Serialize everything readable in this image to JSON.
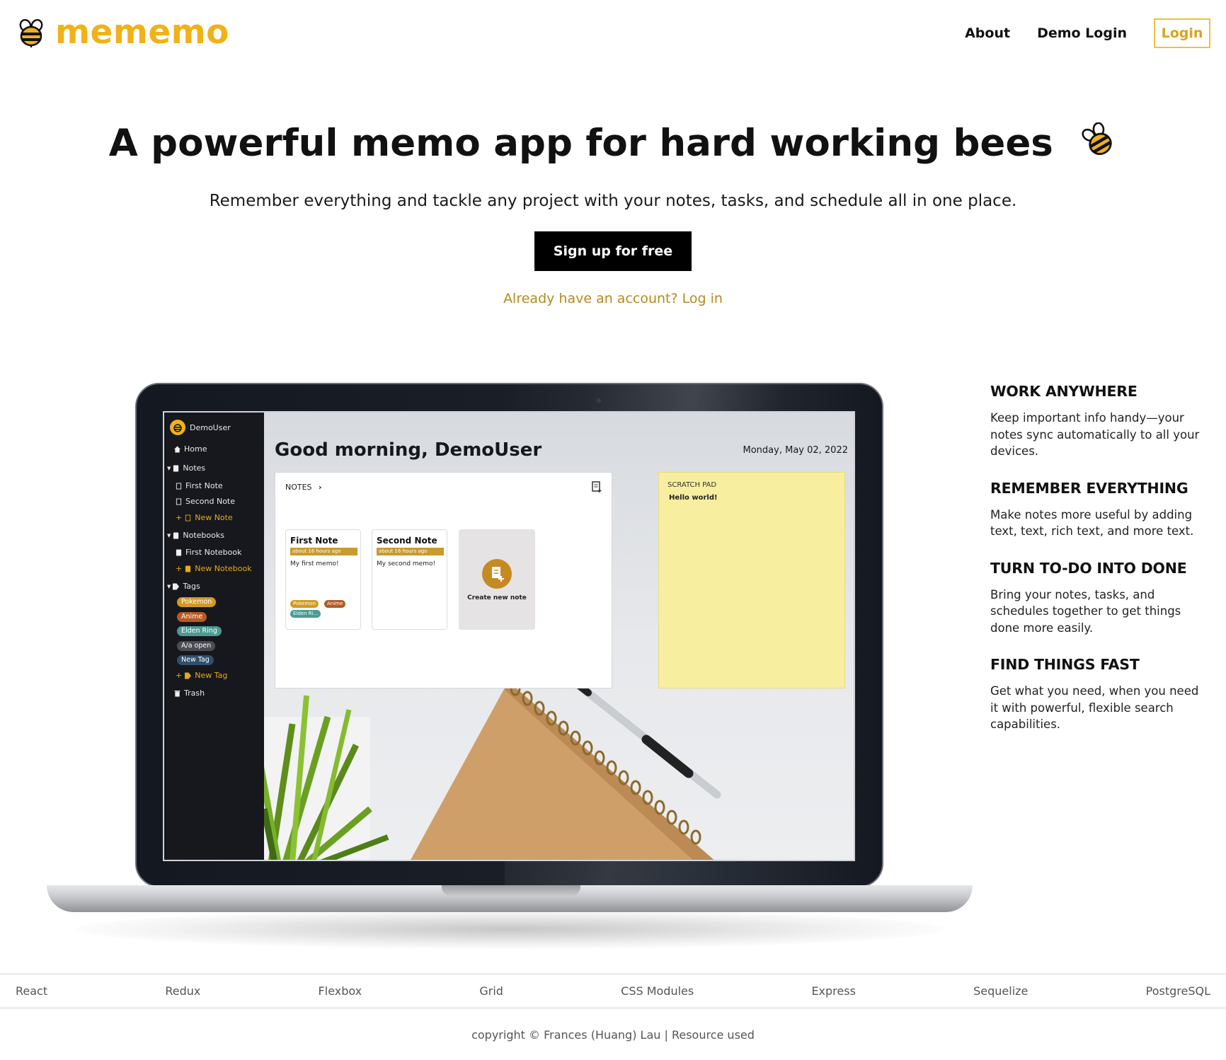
{
  "header": {
    "brand": "mememo",
    "nav": {
      "about": "About",
      "demo_login": "Demo Login",
      "login": "Login"
    }
  },
  "hero": {
    "title": "A powerful memo app for hard working bees",
    "subtitle": "Remember everything and tackle any project with your notes, tasks, and schedule all in one place.",
    "signup": "Sign up for free",
    "login_prompt": "Already have an account? Log in"
  },
  "app_preview": {
    "user": "DemoUser",
    "sidebar": {
      "home": "Home",
      "notes": "Notes",
      "notes_items": [
        "First Note",
        "Second Note"
      ],
      "new_note": "New Note",
      "notebooks": "Notebooks",
      "notebooks_items": [
        "First Notebook"
      ],
      "new_notebook": "New Notebook",
      "tags": "Tags",
      "tag_items": [
        "Pokemon",
        "Anime",
        "Elden Ring",
        "A/a open",
        "New Tag"
      ],
      "new_tag": "New Tag",
      "trash": "Trash"
    },
    "greeting": "Good morning, DemoUser",
    "date": "Monday, May 02, 2022",
    "notes_header": "NOTES",
    "cards": [
      {
        "title": "First Note",
        "ago": "about 16 hours ago",
        "body": "My first memo!",
        "tags": [
          "Pokemon",
          "Anime",
          "Elden Ri..."
        ]
      },
      {
        "title": "Second Note",
        "ago": "about 16 hours ago",
        "body": "My second memo!",
        "tags": []
      }
    ],
    "create_new": "Create new note",
    "scratch_title": "SCRATCH PAD",
    "scratch_body": "Hello world!"
  },
  "features": [
    {
      "heading": "WORK ANYWHERE",
      "text": "Keep important info handy—your notes sync automatically to all your devices."
    },
    {
      "heading": "REMEMBER EVERYTHING",
      "text": "Make notes more useful by adding text, text, rich text, and more text."
    },
    {
      "heading": "TURN TO-DO INTO DONE",
      "text": "Bring your notes, tasks, and schedules together to get things done more easily."
    },
    {
      "heading": "FIND THINGS FAST",
      "text": "Get what you need, when you need it with powerful, flexible search capabilities."
    }
  ],
  "tech_stack": [
    "React",
    "Redux",
    "Flexbox",
    "Grid",
    "CSS Modules",
    "Express",
    "Sequelize",
    "PostgreSQL"
  ],
  "footer": {
    "copyright": "copyright © Frances (Huang) Lau",
    "separator": " | ",
    "resource": "Resource used"
  },
  "colors": {
    "brand": "#f0b21a",
    "link": "#b68b1d",
    "sidebar": "#16181d",
    "scratch": "#f7ee9f"
  }
}
